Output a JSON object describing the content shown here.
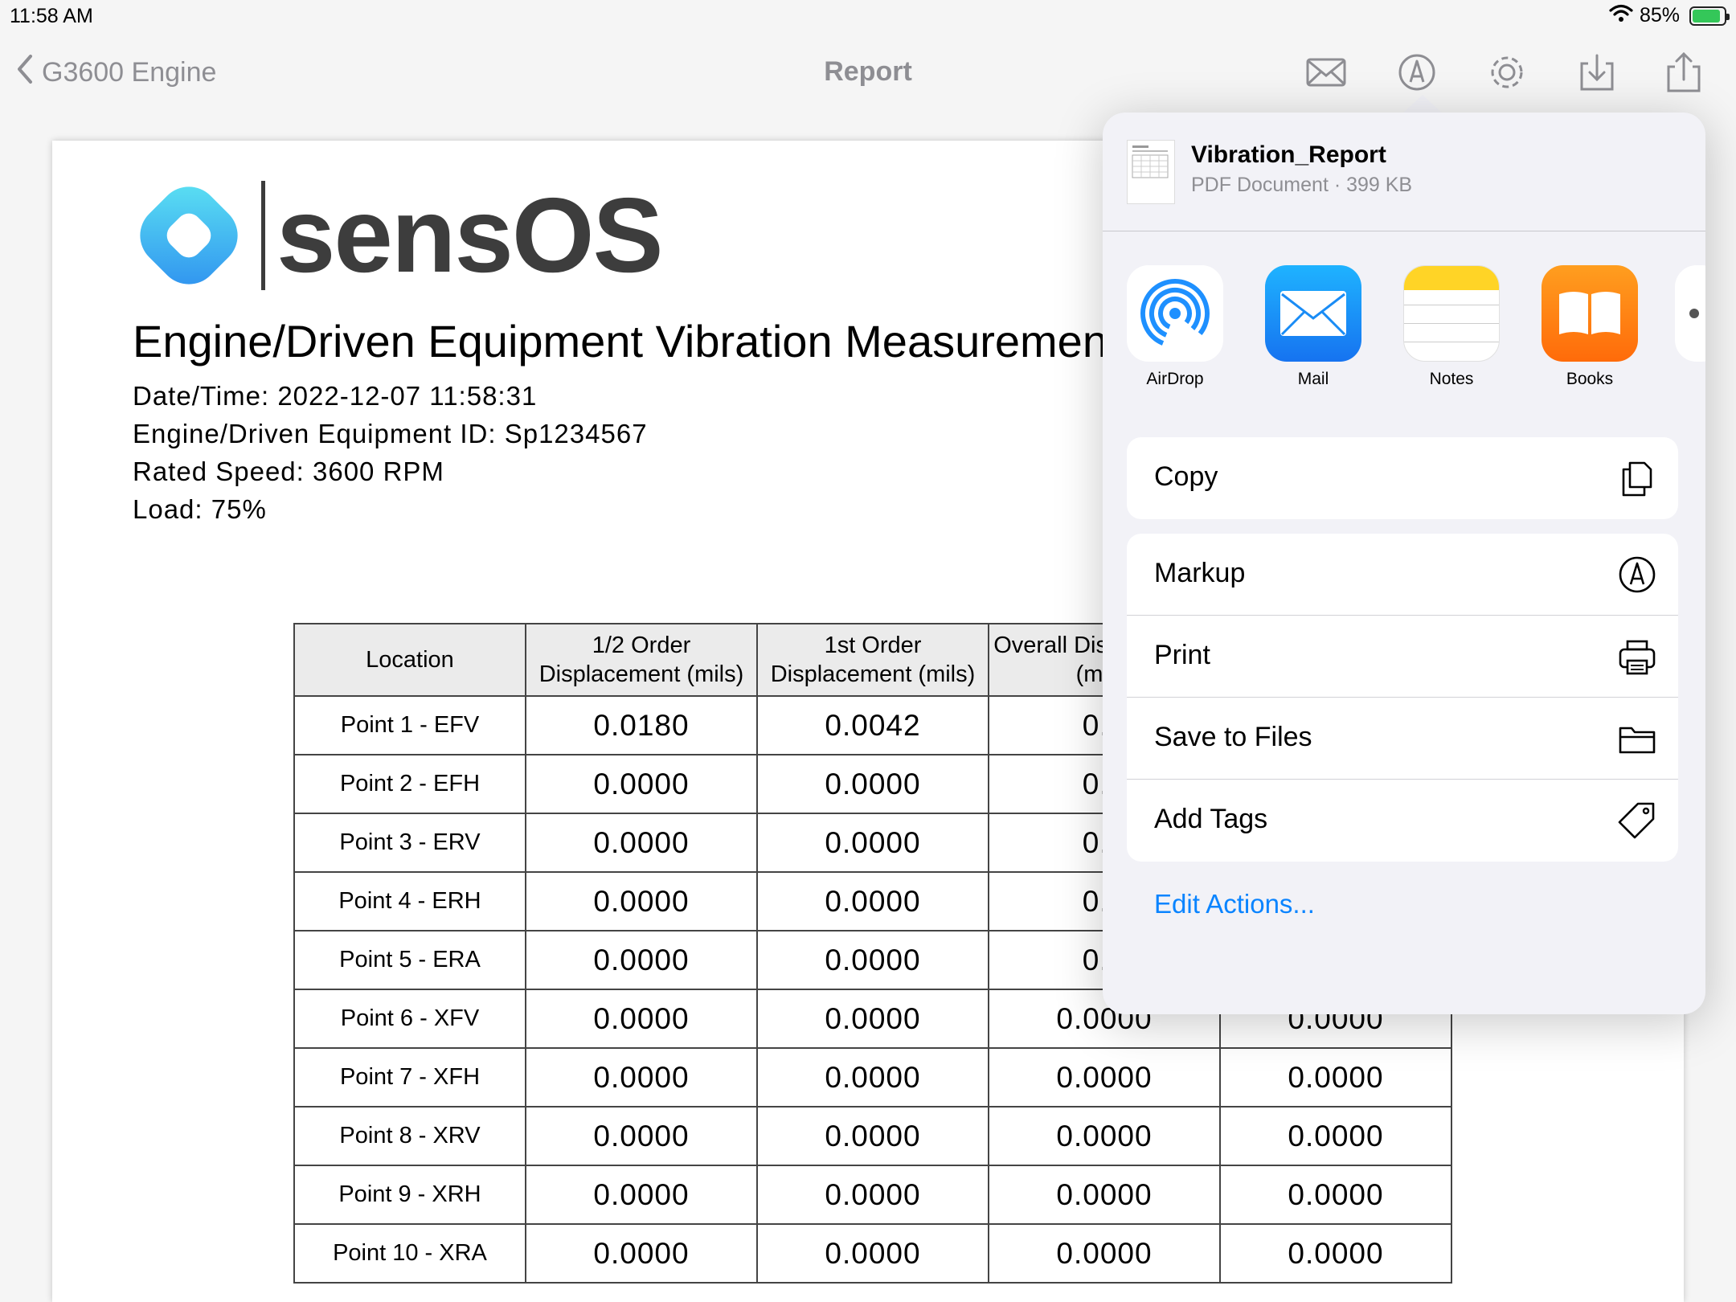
{
  "status_bar": {
    "time": "11:58 AM",
    "battery_percent": "85%"
  },
  "nav": {
    "back_label": "G3600 Engine",
    "title": "Report"
  },
  "report": {
    "logo_text": "sensOS",
    "title": "Engine/Driven Equipment Vibration Measurement",
    "datetime": "Date/Time: 2022-12-07 11:58:31",
    "equipment_id": "Engine/Driven Equipment ID: Sp1234567",
    "rated_speed": "Rated Speed: 3600 RPM",
    "load": "Load: 75%",
    "table": {
      "headers": [
        "Location",
        "1/2 Order\nDisplacement (mils)",
        "1st Order\nDisplacement (mils)",
        "Overall Displacement\n(mils)",
        ""
      ],
      "rows": [
        [
          "Point 1 - EFV",
          "0.0180",
          "0.0042",
          "0.0",
          ""
        ],
        [
          "Point 2 - EFH",
          "0.0000",
          "0.0000",
          "0.0",
          ""
        ],
        [
          "Point 3 - ERV",
          "0.0000",
          "0.0000",
          "0.0",
          ""
        ],
        [
          "Point 4 - ERH",
          "0.0000",
          "0.0000",
          "0.0",
          ""
        ],
        [
          "Point 5 - ERA",
          "0.0000",
          "0.0000",
          "0.0",
          ""
        ],
        [
          "Point 6 - XFV",
          "0.0000",
          "0.0000",
          "0.0000",
          "0.0000"
        ],
        [
          "Point 7 - XFH",
          "0.0000",
          "0.0000",
          "0.0000",
          "0.0000"
        ],
        [
          "Point 8 - XRV",
          "0.0000",
          "0.0000",
          "0.0000",
          "0.0000"
        ],
        [
          "Point 9 - XRH",
          "0.0000",
          "0.0000",
          "0.0000",
          "0.0000"
        ],
        [
          "Point 10 - XRA",
          "0.0000",
          "0.0000",
          "0.0000",
          "0.0000"
        ]
      ]
    }
  },
  "share": {
    "file_name": "Vibration_Report",
    "file_meta": "PDF Document · 399 KB",
    "apps": [
      {
        "label": "AirDrop",
        "icon": "airdrop-icon"
      },
      {
        "label": "Mail",
        "icon": "mail-icon"
      },
      {
        "label": "Notes",
        "icon": "notes-icon"
      },
      {
        "label": "Books",
        "icon": "books-icon"
      }
    ],
    "copy_label": "Copy",
    "markup_label": "Markup",
    "print_label": "Print",
    "save_to_files_label": "Save to Files",
    "add_tags_label": "Add Tags",
    "edit_actions_label": "Edit Actions..."
  },
  "colors": {
    "accent": "#0a84ff",
    "nav_gray": "#8e8e93",
    "battery_green": "#34c759"
  }
}
